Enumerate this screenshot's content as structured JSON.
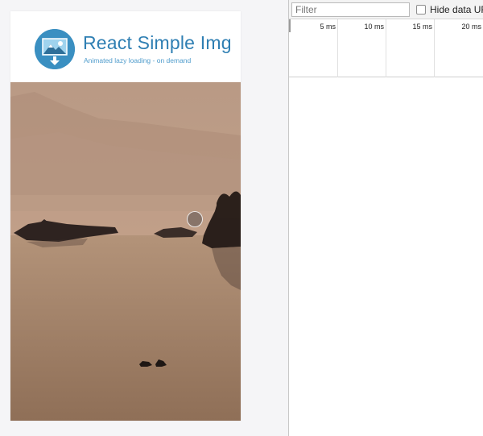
{
  "app": {
    "title": "React Simple Img",
    "subtitle": "Animated lazy loading - on demand",
    "logo_icon": "image-download-icon",
    "brand_color": "#2f7fb3",
    "image_alt": "misty lake with rocks, trees and ducks"
  },
  "network": {
    "filter_placeholder": "Filter",
    "filter_value": "",
    "hide_data_urls_label": "Hide data URLs",
    "hide_data_urls_checked": false,
    "timeline_ticks": [
      "5 ms",
      "10 ms",
      "15 ms",
      "20 ms"
    ]
  }
}
